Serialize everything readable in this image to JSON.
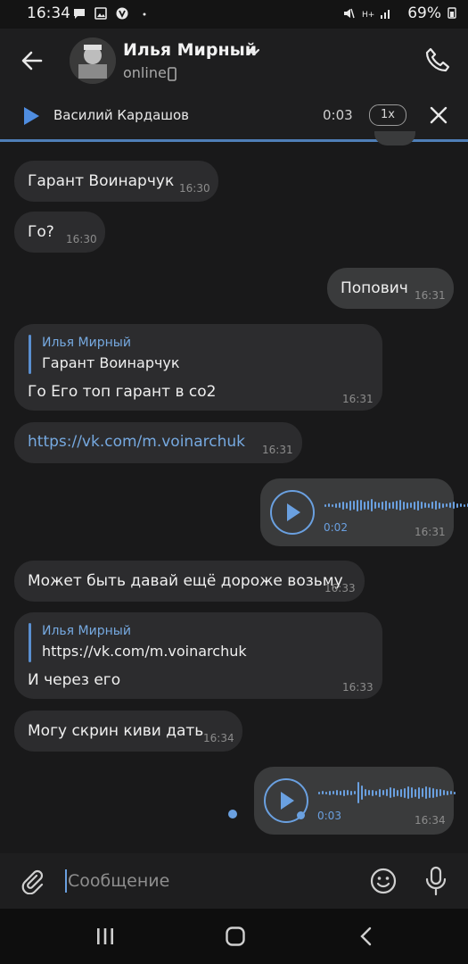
{
  "status_bar": {
    "time": "16:34",
    "battery": "69%"
  },
  "header": {
    "name": "Илья Мирный",
    "status": "online"
  },
  "player": {
    "track": "Василий Кардашов",
    "time": "0:03",
    "speed": "1x"
  },
  "messages": [
    {
      "type": "in",
      "text": "Гарант Воинарчук",
      "time": "16:30"
    },
    {
      "type": "in",
      "text": "Го?",
      "time": "16:30"
    },
    {
      "type": "out",
      "text": "Попович",
      "time": "16:31"
    },
    {
      "type": "in",
      "reply_name": "Илья Мирный",
      "reply_text": "Гарант Воинарчук",
      "text": "Го Его топ гарант в со2",
      "time": "16:31"
    },
    {
      "type": "in",
      "text": "https://vk.com/m.voinarchuk",
      "time": "16:31"
    },
    {
      "type": "out_voice",
      "duration": "0:02",
      "time": "16:31"
    },
    {
      "type": "in",
      "text": "Может быть давай ещё дороже возьму",
      "time": "16:33"
    },
    {
      "type": "in",
      "reply_name": "Илья Мирный",
      "reply_text": "https://vk.com/m.voinarchuk",
      "text": "И через его",
      "time": "16:33"
    },
    {
      "type": "in",
      "text": "Могу скрин киви дать",
      "time": "16:34"
    },
    {
      "type": "out_voice",
      "duration": "0:03",
      "time": "16:34"
    }
  ],
  "composer": {
    "placeholder": "Сообщение"
  },
  "colors": {
    "accent": "#6aa0e0",
    "background": "#19191a",
    "bubble_in": "#2c2c2e",
    "bubble_out": "#3a3b3c"
  },
  "icons": [
    "back-arrow-icon",
    "phone-icon",
    "play-icon",
    "close-icon",
    "attach-icon",
    "emoji-icon",
    "mic-icon",
    "recents-icon",
    "home-icon",
    "back-nav-icon"
  ]
}
